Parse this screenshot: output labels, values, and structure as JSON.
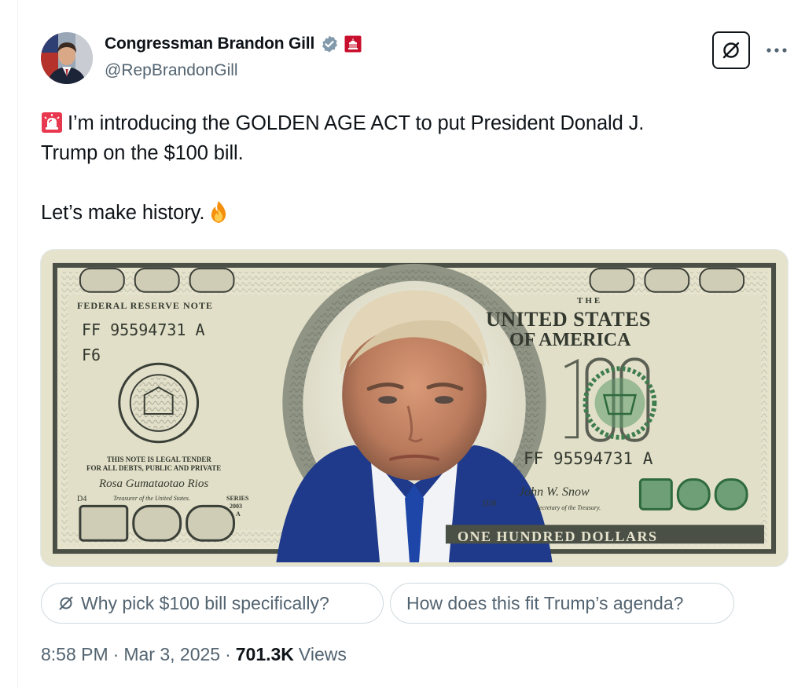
{
  "author": {
    "display_name": "Congressman Brandon Gill",
    "handle": "@RepBrandonGill",
    "avatar_icon": "profile-photo",
    "verified_icon": "verified-badge-icon",
    "affiliation_icon": "us-capitol-badge-icon"
  },
  "actions": {
    "grok_icon": "grok-icon",
    "more_icon": "more-icon"
  },
  "tweet": {
    "line1": "I’m introducing the GOLDEN AGE ACT to put President Donald J.",
    "line2": "Trump on the $100 bill.",
    "line3": "Let’s make history.",
    "lead_emoji": "rotating-light-icon",
    "trail_emoji": "fire-icon"
  },
  "media": {
    "banknote": {
      "big_denomination": "100",
      "header": "FEDERAL RESERVE NOTE",
      "serial_top": "FF 95594731 A",
      "district_code": "F6",
      "country_small": "THE",
      "country_line1": "UNITED STATES",
      "country_line2": "OF AMERICA",
      "serial_right": "FF 95594731 A",
      "legal_tender_line1": "THIS NOTE IS LEGAL TENDER",
      "legal_tender_line2": "FOR ALL DEBTS, PUBLIC AND PRIVATE",
      "signature_left": "Rosa Gumataotao Rios",
      "treasurer_title": "Treasurer of the United States.",
      "series_label": "SERIES",
      "series_year": "2003",
      "series_letter": "A",
      "plate_left": "D4",
      "plate_right": "D38",
      "signature_right": "John W. Snow",
      "secretary_title": "Secretary of the Treasury.",
      "denomination_words": "ONE HUNDRED DOLLARS",
      "seal_left_text": "FEDERAL RESERVE SYSTEM",
      "seal_right_text": "TREASURY",
      "colors": {
        "paper": "#e6e3cd",
        "ink": "#3a3f37",
        "seal_green": "#3f7d4f"
      }
    }
  },
  "suggestions": [
    {
      "label": "Why pick $100 bill specifically?",
      "icon": "grok-icon"
    },
    {
      "label": "How does this fit Trump’s agenda?"
    }
  ],
  "meta": {
    "time": "8:58 PM",
    "separator": "·",
    "date": "Mar 3, 2025",
    "views_count": "701.3K",
    "views_label": "Views"
  }
}
